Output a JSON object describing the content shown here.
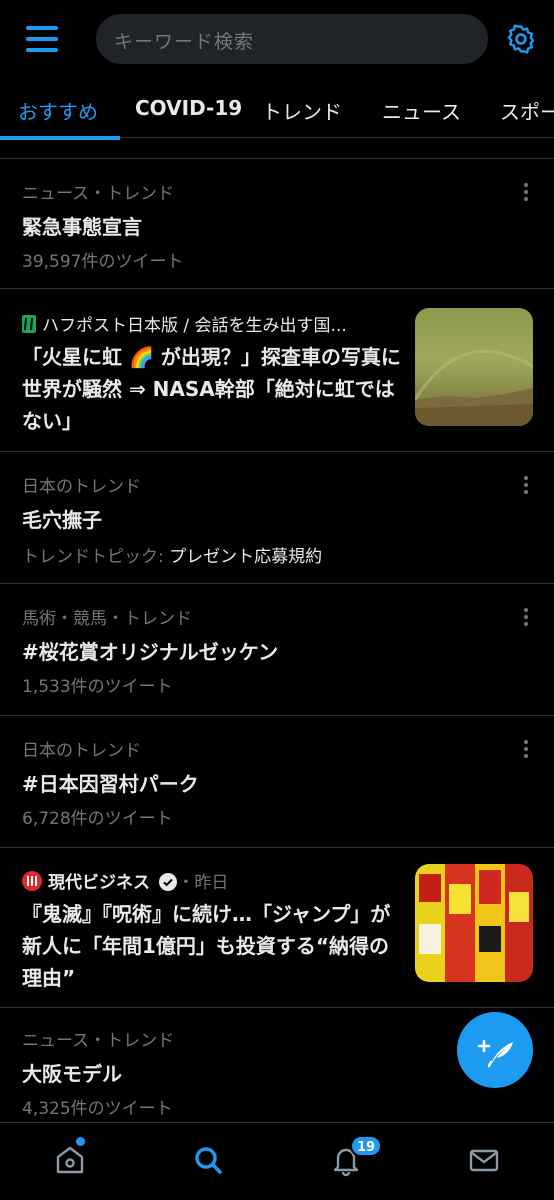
{
  "header": {
    "search_placeholder": "キーワード検索",
    "menu_icon": "hamburger-menu-icon",
    "settings_icon": "gear-icon"
  },
  "tabs": [
    {
      "label": "おすすめ",
      "active": true
    },
    {
      "label": "COVID-19"
    },
    {
      "label": "トレンド"
    },
    {
      "label": "ニュース"
    },
    {
      "label": "スポー"
    }
  ],
  "feed": {
    "trend1": {
      "context": "ニュース・トレンド",
      "title": "緊急事態宣言",
      "count": "39,597件のツイート"
    },
    "news1": {
      "source": "ハフポスト日本版 / 会話を生み出す国...",
      "title": "「火星に虹 🌈 が出現？」探査車の写真に世界が騒然 ⇒ NASA幹部「絶対に虹ではない」",
      "thumb": "mars-rainbow-photo"
    },
    "trend2": {
      "context": "日本のトレンド",
      "title": "毛穴撫子",
      "topic_label": "トレンドトピック: ",
      "topic": "プレゼント応募規約"
    },
    "trend3": {
      "context": "馬術・競馬・トレンド",
      "title": "#桜花賞オリジナルゼッケン",
      "count": "1,533件のツイート"
    },
    "trend4": {
      "context": "日本のトレンド",
      "title": "#日本因習村パーク",
      "count": "6,728件のツイート"
    },
    "news2": {
      "source": "現代ビジネス",
      "time": "・昨日",
      "title": "『鬼滅』『呪術』に続け…「ジャンプ」が新人に「年間1億円」も投資する“納得の理由”",
      "thumb": "jump-magazine-covers"
    },
    "trend5": {
      "context": "ニュース・トレンド",
      "title": "大阪モデル",
      "count": "4,325件のツイート"
    }
  },
  "bottom_nav": {
    "home_icon": "home-icon",
    "search_icon": "search-icon",
    "notifications_icon": "bell-icon",
    "notifications_badge": "19",
    "messages_icon": "mail-icon"
  },
  "fab_icon": "compose-tweet-icon",
  "colors": {
    "accent": "#1d9bf0",
    "background": "#000000",
    "muted": "#71767b"
  }
}
